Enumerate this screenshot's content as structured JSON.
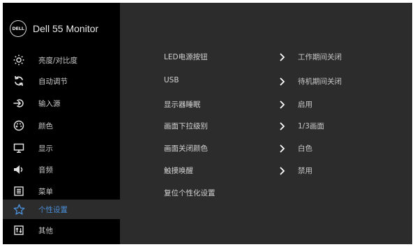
{
  "brand": {
    "title": "Dell 55 Monitor",
    "logo_text": "DELL"
  },
  "sidebar": {
    "items": [
      {
        "label": "亮度/对比度",
        "icon": "brightness-icon",
        "active": false
      },
      {
        "label": "自动调节",
        "icon": "auto-adjust-icon",
        "active": false
      },
      {
        "label": "输入源",
        "icon": "input-source-icon",
        "active": false
      },
      {
        "label": "颜色",
        "icon": "color-palette-icon",
        "active": false
      },
      {
        "label": "显示",
        "icon": "display-icon",
        "active": false
      },
      {
        "label": "音频",
        "icon": "speaker-icon",
        "active": false
      },
      {
        "label": "菜单",
        "icon": "menu-list-icon",
        "active": false
      },
      {
        "label": "个性设置",
        "icon": "star-icon",
        "active": true
      },
      {
        "label": "其他",
        "icon": "others-icon",
        "active": false
      }
    ]
  },
  "settings": {
    "rows": [
      {
        "label": "LED电源按钮",
        "value": "工作期间关闭"
      },
      {
        "label": "USB",
        "value": "待机期间关闭"
      },
      {
        "label": "显示器睡眠",
        "value": "启用"
      },
      {
        "label": "画面下拉级别",
        "value": "1/3画面"
      },
      {
        "label": "画面关闭颜色",
        "value": "白色"
      },
      {
        "label": "触摸唤醒",
        "value": "禁用"
      },
      {
        "label": "复位个性化设置",
        "value": ""
      }
    ]
  },
  "colors": {
    "sidebar_bg": "#000000",
    "panel_bg": "#2c2c2c",
    "accent": "#4a8fd8",
    "text": "#c8c8c8"
  }
}
